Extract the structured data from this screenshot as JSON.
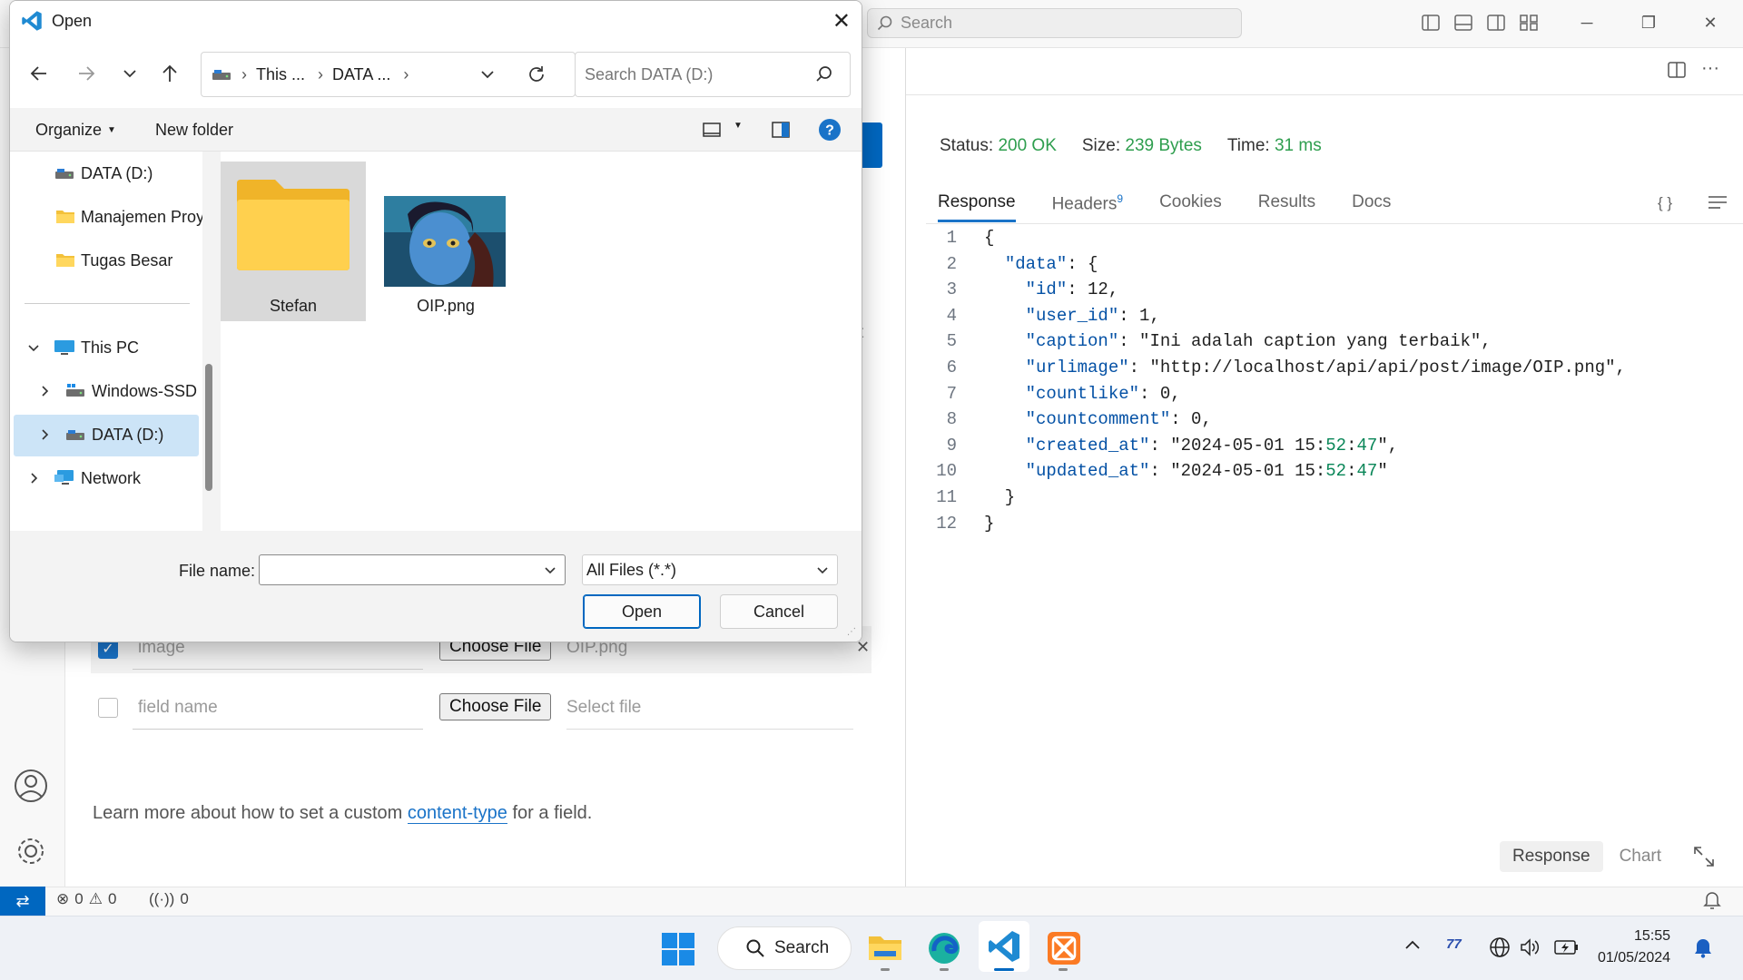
{
  "colors": {
    "accent": "#0067c0",
    "status_green": "#2e9e4e",
    "code_key": "#0451a5",
    "code_string": "#a31515",
    "code_number": "#098658"
  },
  "vscode": {
    "search_placeholder": "Search",
    "response": {
      "status_label": "Status:",
      "status_value": "200 OK",
      "size_label": "Size:",
      "size_value": "239 Bytes",
      "time_label": "Time:",
      "time_value": "31 ms",
      "tabs": [
        {
          "label": "Response",
          "active": true
        },
        {
          "label": "Headers",
          "badge": "9"
        },
        {
          "label": "Cookies"
        },
        {
          "label": "Results"
        },
        {
          "label": "Docs"
        }
      ],
      "braces_icon_label": "{ }",
      "code_lines": [
        {
          "n": "1",
          "text": "{"
        },
        {
          "n": "2",
          "text": "  \"data\": {"
        },
        {
          "n": "3",
          "text": "    \"id\": 12,"
        },
        {
          "n": "4",
          "text": "    \"user_id\": 1,"
        },
        {
          "n": "5",
          "text": "    \"caption\": \"Ini adalah caption yang terbaik\","
        },
        {
          "n": "6",
          "text": "    \"urlimage\": \"http://localhost/api/api/post/image/OIP.png\","
        },
        {
          "n": "7",
          "text": "    \"countlike\": 0,"
        },
        {
          "n": "8",
          "text": "    \"countcomment\": 0,"
        },
        {
          "n": "9",
          "text": "    \"created_at\": \"2024-05-01 15:52:47\","
        },
        {
          "n": "10",
          "text": "    \"updated_at\": \"2024-05-01 15:52:47\""
        },
        {
          "n": "11",
          "text": "  }"
        },
        {
          "n": "12",
          "text": "}"
        }
      ],
      "view_toggle": [
        "Response",
        "Chart"
      ]
    },
    "form": {
      "rows": [
        {
          "checked": true,
          "field": "image",
          "button": "Choose File",
          "file": "OIP.png"
        },
        {
          "checked": false,
          "field": "field name",
          "button": "Choose File",
          "file": "Select file"
        }
      ],
      "learn_prefix": "Learn more about how to set a custom ",
      "learn_link": "content-type",
      "learn_suffix": " for a field."
    },
    "statusbar": {
      "errors": "0",
      "warnings": "0",
      "ports": "0"
    },
    "partial_char": "t"
  },
  "dialog": {
    "title": "Open",
    "breadcrumb": [
      "This ...",
      "DATA ..."
    ],
    "search_placeholder": "Search DATA (D:)",
    "organize": "Organize",
    "new_folder": "New folder",
    "nav_items": [
      {
        "label": "DATA (D:)",
        "icon": "drive-icon"
      },
      {
        "label": "Manajemen Proy",
        "icon": "folder-icon"
      },
      {
        "label": "Tugas Besar",
        "icon": "folder-icon"
      },
      {
        "label": "This PC",
        "icon": "pc-icon",
        "expanded": true
      },
      {
        "label": "Windows-SSD",
        "icon": "drive-icon"
      },
      {
        "label": "DATA (D:)",
        "icon": "drive-icon",
        "selected": true
      },
      {
        "label": "Network",
        "icon": "network-icon"
      }
    ],
    "files": [
      {
        "name": "Stefan",
        "type": "folder",
        "selected": true
      },
      {
        "name": "OIP.png",
        "type": "image"
      }
    ],
    "filename_label": "File name:",
    "filename_value": "",
    "filter_value": "All Files (*.*)",
    "open_button": "Open",
    "cancel_button": "Cancel"
  },
  "taskbar": {
    "search_label": "Search",
    "tray_badge": "77",
    "time": "15:55",
    "date": "01/05/2024"
  }
}
